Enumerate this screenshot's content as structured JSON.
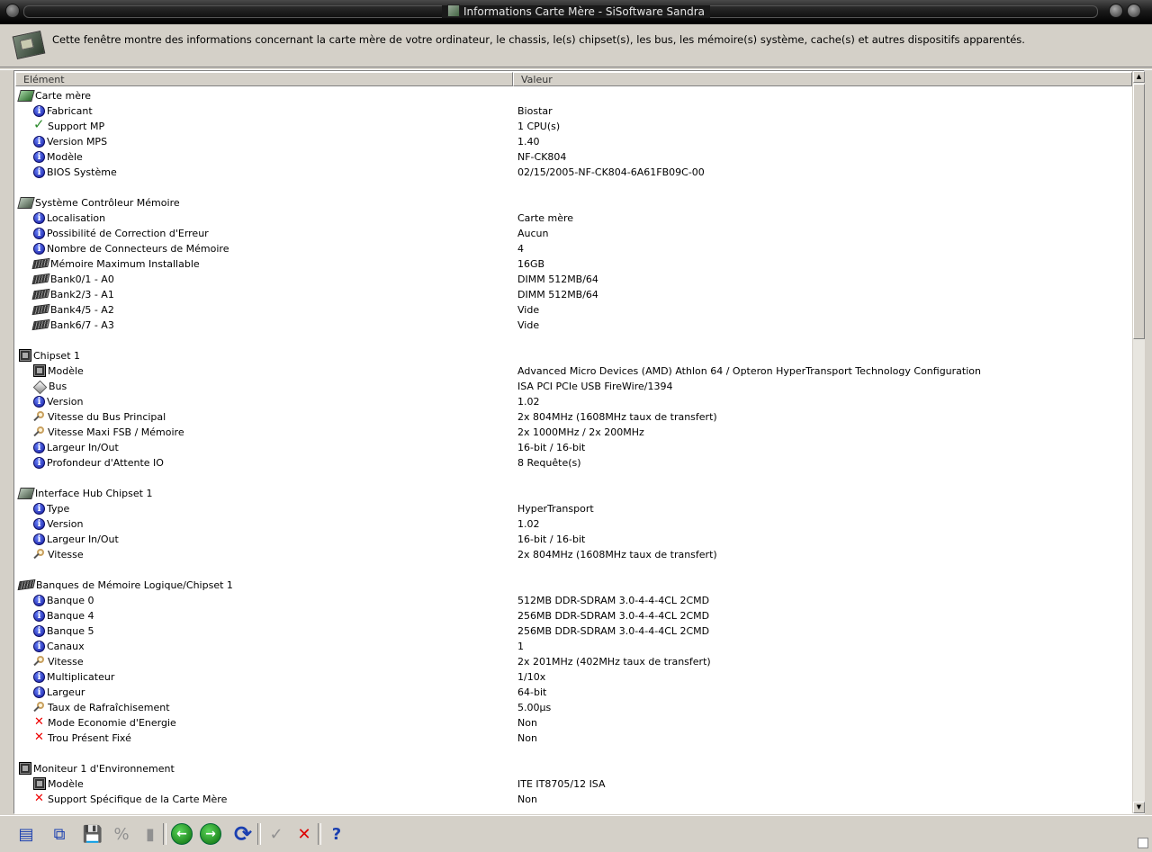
{
  "window": {
    "title": "Informations Carte Mère - SiSoftware Sandra"
  },
  "header": {
    "description": "Cette fenêtre montre des informations concernant la carte mère de votre ordinateur, le chassis, le(s) chipset(s), les bus, les mémoire(s) système, cache(s) et autres dispositifs apparentés."
  },
  "columns": {
    "element": "Elément",
    "value": "Valeur"
  },
  "rows": [
    {
      "type": "cat",
      "icon": "motherboard-green-icon",
      "label": "Carte mère",
      "value": ""
    },
    {
      "type": "item",
      "icon": "info-icon",
      "label": "Fabricant",
      "value": "Biostar"
    },
    {
      "type": "item",
      "icon": "check-icon",
      "label": "Support MP",
      "value": "1 CPU(s)"
    },
    {
      "type": "item",
      "icon": "info-icon",
      "label": "Version MPS",
      "value": "1.40"
    },
    {
      "type": "item",
      "icon": "info-icon",
      "label": "Modèle",
      "value": "NF-CK804"
    },
    {
      "type": "item",
      "icon": "info-icon",
      "label": "BIOS Système",
      "value": "02/15/2005-NF-CK804-6A61FB09C-00"
    },
    {
      "type": "blank"
    },
    {
      "type": "cat",
      "icon": "motherboard-icon",
      "label": "Système Contrôleur Mémoire",
      "value": ""
    },
    {
      "type": "item",
      "icon": "info-icon",
      "label": "Localisation",
      "value": "Carte mère"
    },
    {
      "type": "item",
      "icon": "info-icon",
      "label": "Possibilité de Correction d'Erreur",
      "value": "Aucun"
    },
    {
      "type": "item",
      "icon": "info-icon",
      "label": "Nombre de Connecteurs de Mémoire",
      "value": "4"
    },
    {
      "type": "item",
      "icon": "memory-icon",
      "label": "Mémoire Maximum Installable",
      "value": "16GB"
    },
    {
      "type": "item",
      "icon": "memory-icon",
      "label": "Bank0/1 - A0",
      "value": "DIMM 512MB/64"
    },
    {
      "type": "item",
      "icon": "memory-icon",
      "label": "Bank2/3 - A1",
      "value": "DIMM 512MB/64"
    },
    {
      "type": "item",
      "icon": "memory-icon",
      "label": "Bank4/5 - A2",
      "value": "Vide"
    },
    {
      "type": "item",
      "icon": "memory-icon",
      "label": "Bank6/7 - A3",
      "value": "Vide"
    },
    {
      "type": "blank"
    },
    {
      "type": "cat",
      "icon": "chip-icon",
      "label": "Chipset 1",
      "value": ""
    },
    {
      "type": "item",
      "icon": "chip-icon",
      "label": "Modèle",
      "value": "Advanced Micro Devices (AMD) Athlon 64 / Opteron HyperTransport Technology Configuration"
    },
    {
      "type": "item",
      "icon": "bus-icon",
      "label": "Bus",
      "value": "ISA PCI PCIe USB FireWire/1394"
    },
    {
      "type": "item",
      "icon": "info-icon",
      "label": "Version",
      "value": "1.02"
    },
    {
      "type": "item",
      "icon": "probe-icon",
      "label": "Vitesse du Bus Principal",
      "value": "2x 804MHz (1608MHz taux de transfert)"
    },
    {
      "type": "item",
      "icon": "probe-icon",
      "label": "Vitesse Maxi FSB / Mémoire",
      "value": "2x 1000MHz / 2x 200MHz"
    },
    {
      "type": "item",
      "icon": "info-icon",
      "label": "Largeur In/Out",
      "value": "16-bit / 16-bit"
    },
    {
      "type": "item",
      "icon": "info-icon",
      "label": "Profondeur d'Attente IO",
      "value": "8 Requête(s)"
    },
    {
      "type": "blank"
    },
    {
      "type": "cat",
      "icon": "motherboard-icon",
      "label": "Interface Hub Chipset 1",
      "value": ""
    },
    {
      "type": "item",
      "icon": "info-icon",
      "label": "Type",
      "value": "HyperTransport"
    },
    {
      "type": "item",
      "icon": "info-icon",
      "label": "Version",
      "value": "1.02"
    },
    {
      "type": "item",
      "icon": "info-icon",
      "label": "Largeur In/Out",
      "value": "16-bit / 16-bit"
    },
    {
      "type": "item",
      "icon": "probe-icon",
      "label": "Vitesse",
      "value": "2x 804MHz (1608MHz taux de transfert)"
    },
    {
      "type": "blank"
    },
    {
      "type": "cat",
      "icon": "memory-icon",
      "label": "Banques de Mémoire Logique/Chipset 1",
      "value": ""
    },
    {
      "type": "item",
      "icon": "info-icon",
      "label": "Banque 0",
      "value": "512MB DDR-SDRAM 3.0-4-4-4CL 2CMD"
    },
    {
      "type": "item",
      "icon": "info-icon",
      "label": "Banque 4",
      "value": "256MB DDR-SDRAM 3.0-4-4-4CL 2CMD"
    },
    {
      "type": "item",
      "icon": "info-icon",
      "label": "Banque 5",
      "value": "256MB DDR-SDRAM 3.0-4-4-4CL 2CMD"
    },
    {
      "type": "item",
      "icon": "info-icon",
      "label": "Canaux",
      "value": "1"
    },
    {
      "type": "item",
      "icon": "probe-icon",
      "label": "Vitesse",
      "value": "2x 201MHz (402MHz taux de transfert)"
    },
    {
      "type": "item",
      "icon": "info-icon",
      "label": "Multiplicateur",
      "value": "1/10x"
    },
    {
      "type": "item",
      "icon": "info-icon",
      "label": "Largeur",
      "value": "64-bit"
    },
    {
      "type": "item",
      "icon": "probe-icon",
      "label": "Taux de Rafraîchisement",
      "value": "5.00µs"
    },
    {
      "type": "item",
      "icon": "cross-icon",
      "label": "Mode Economie d'Energie",
      "value": "Non"
    },
    {
      "type": "item",
      "icon": "cross-icon",
      "label": "Trou Présent Fixé",
      "value": "Non"
    },
    {
      "type": "blank"
    },
    {
      "type": "cat",
      "icon": "chip-icon",
      "label": "Moniteur 1 d'Environnement",
      "value": ""
    },
    {
      "type": "item",
      "icon": "chip-icon",
      "label": "Modèle",
      "value": "ITE IT8705/12 ISA"
    },
    {
      "type": "item",
      "icon": "cross-icon",
      "label": "Support Spécifique de la Carte Mère",
      "value": "Non"
    }
  ],
  "toolbar": {
    "buttons": [
      {
        "name": "report-button",
        "icon": "report-icon",
        "glyph": "▤"
      },
      {
        "name": "copy-button",
        "icon": "copy-icon",
        "glyph": "⧉"
      },
      {
        "name": "save-button",
        "icon": "save-icon",
        "glyph": "💾"
      },
      {
        "name": "percent-button",
        "icon": "percent-icon",
        "glyph": "%"
      },
      {
        "name": "chart-button",
        "icon": "bar-chart-icon",
        "glyph": "▮"
      },
      {
        "name": "back-button",
        "icon": "arrow-left-icon",
        "glyph": "←"
      },
      {
        "name": "forward-button",
        "icon": "arrow-right-icon",
        "glyph": "→"
      },
      {
        "name": "refresh-button",
        "icon": "refresh-icon",
        "glyph": "⟳"
      },
      {
        "name": "ok-button",
        "icon": "check-icon",
        "glyph": "✓"
      },
      {
        "name": "close-button",
        "icon": "cross-icon",
        "glyph": "✕"
      },
      {
        "name": "help-button",
        "icon": "help-pointer-icon",
        "glyph": "?"
      }
    ]
  }
}
